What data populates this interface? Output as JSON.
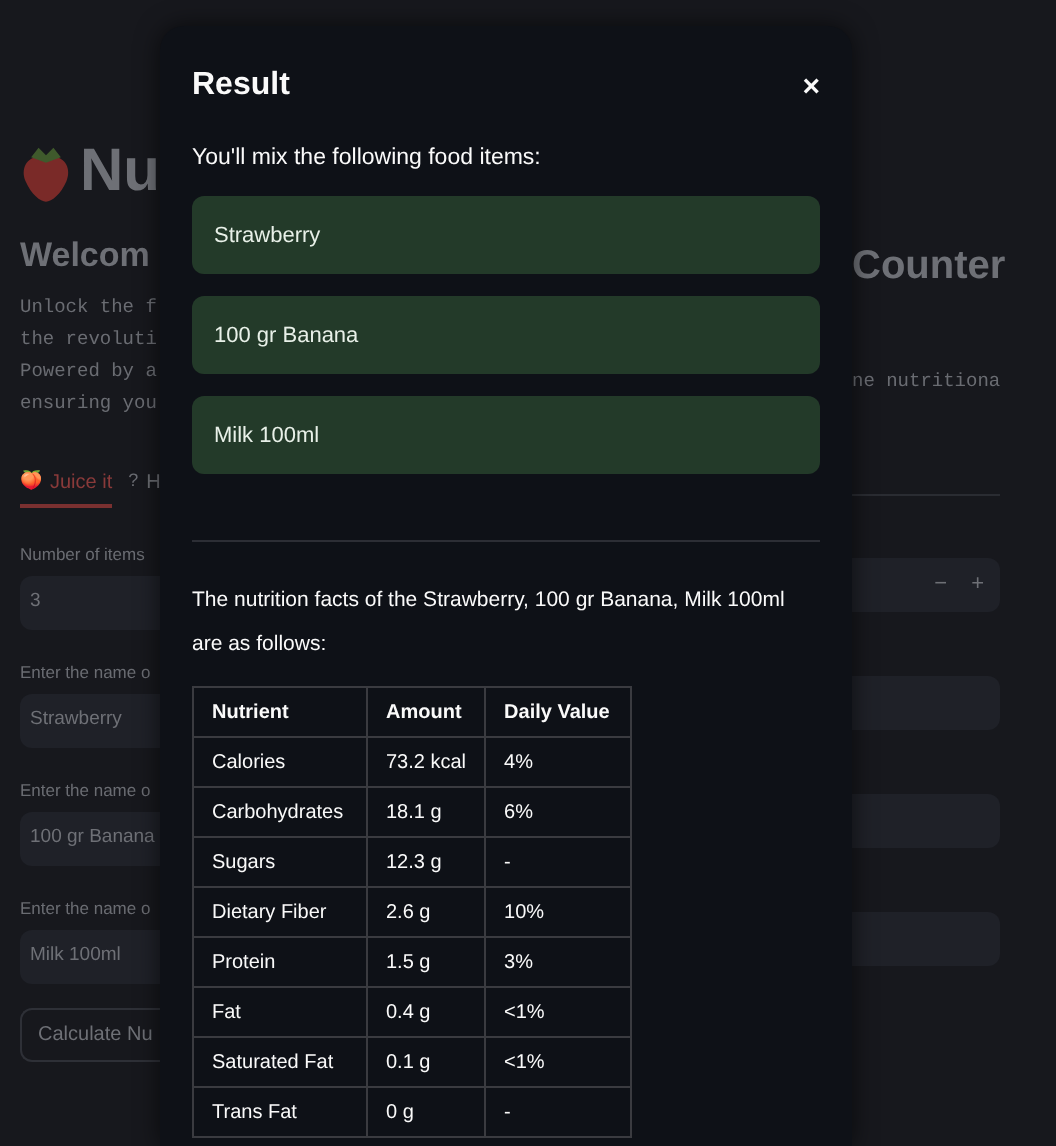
{
  "page": {
    "title": "Nu",
    "heading_left": "Welcom",
    "heading_right": "Counter",
    "intro_left": [
      "Unlock the f",
      "the revoluti",
      "Powered by a",
      "ensuring you"
    ],
    "intro_right": "ne nutritiona",
    "tabs": [
      {
        "icon": "🍑",
        "label": "Juice it",
        "selected": true
      },
      {
        "icon": "?",
        "label": "H",
        "selected": false
      }
    ],
    "fields": [
      {
        "kind": "number",
        "label": "Number of items",
        "value": "3",
        "minus": "−",
        "plus": "+"
      },
      {
        "kind": "text",
        "label": "Enter the name o",
        "value": "Strawberry"
      },
      {
        "kind": "text",
        "label": "Enter the name o",
        "value": "100 gr Banana"
      },
      {
        "kind": "text",
        "label": "Enter the name o",
        "value": "Milk 100ml"
      }
    ],
    "button": "Calculate Nu"
  },
  "dialog": {
    "title": "Result",
    "close": "×",
    "intro": "You'll mix the following food items:",
    "items": [
      "Strawberry",
      "100 gr Banana",
      "Milk 100ml"
    ],
    "summary": "The nutrition facts of the Strawberry, 100 gr Banana, Milk 100ml are as follows:",
    "table": {
      "columns": [
        "Nutrient",
        "Amount",
        "Daily Value"
      ],
      "rows": [
        [
          "Calories",
          "73.2 kcal",
          "4%"
        ],
        [
          "Carbohydrates",
          "18.1 g",
          "6%"
        ],
        [
          "Sugars",
          "12.3 g",
          "-"
        ],
        [
          "Dietary Fiber",
          "2.6 g",
          "10%"
        ],
        [
          "Protein",
          "1.5 g",
          "3%"
        ],
        [
          "Fat",
          "0.4 g",
          "<1%"
        ],
        [
          "Saturated Fat",
          "0.1 g",
          "<1%"
        ],
        [
          "Trans Fat",
          "0 g",
          "-"
        ]
      ]
    }
  }
}
